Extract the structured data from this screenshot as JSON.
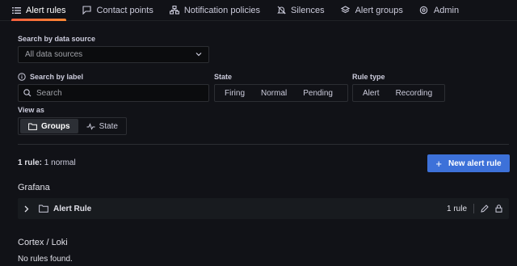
{
  "tabs": [
    {
      "label": "Alert rules",
      "icon": "list-icon",
      "active": true
    },
    {
      "label": "Contact points",
      "icon": "comment-alt-share-icon",
      "active": false
    },
    {
      "label": "Notification policies",
      "icon": "sitemap-icon",
      "active": false
    },
    {
      "label": "Silences",
      "icon": "bell-slash-icon",
      "active": false
    },
    {
      "label": "Alert groups",
      "icon": "layer-group-icon",
      "active": false
    },
    {
      "label": "Admin",
      "icon": "cog-icon",
      "active": false
    }
  ],
  "filters": {
    "datasource_label": "Search by data source",
    "datasource_value": "All data sources",
    "search_label": "Search by label",
    "search_placeholder": "Search",
    "state_label": "State",
    "state_options": [
      "Firing",
      "Normal",
      "Pending"
    ],
    "ruletype_label": "Rule type",
    "ruletype_options": [
      "Alert",
      "Recording"
    ],
    "viewas_label": "View as",
    "viewas_options": [
      "Groups",
      "State"
    ],
    "viewas_selected": "Groups"
  },
  "summary": {
    "count_bold": "1 rule:",
    "count_rest": " 1 normal",
    "new_rule_label": "New alert rule"
  },
  "sections": {
    "grafana_title": "Grafana",
    "folder_name": "Alert Rule",
    "folder_count": "1 rule",
    "cortex_title": "Cortex / Loki",
    "cortex_empty": "No rules found."
  },
  "colors": {
    "background": "#111217",
    "primary": "#3d71d9",
    "active_tab_underline": "#f55f3e"
  }
}
